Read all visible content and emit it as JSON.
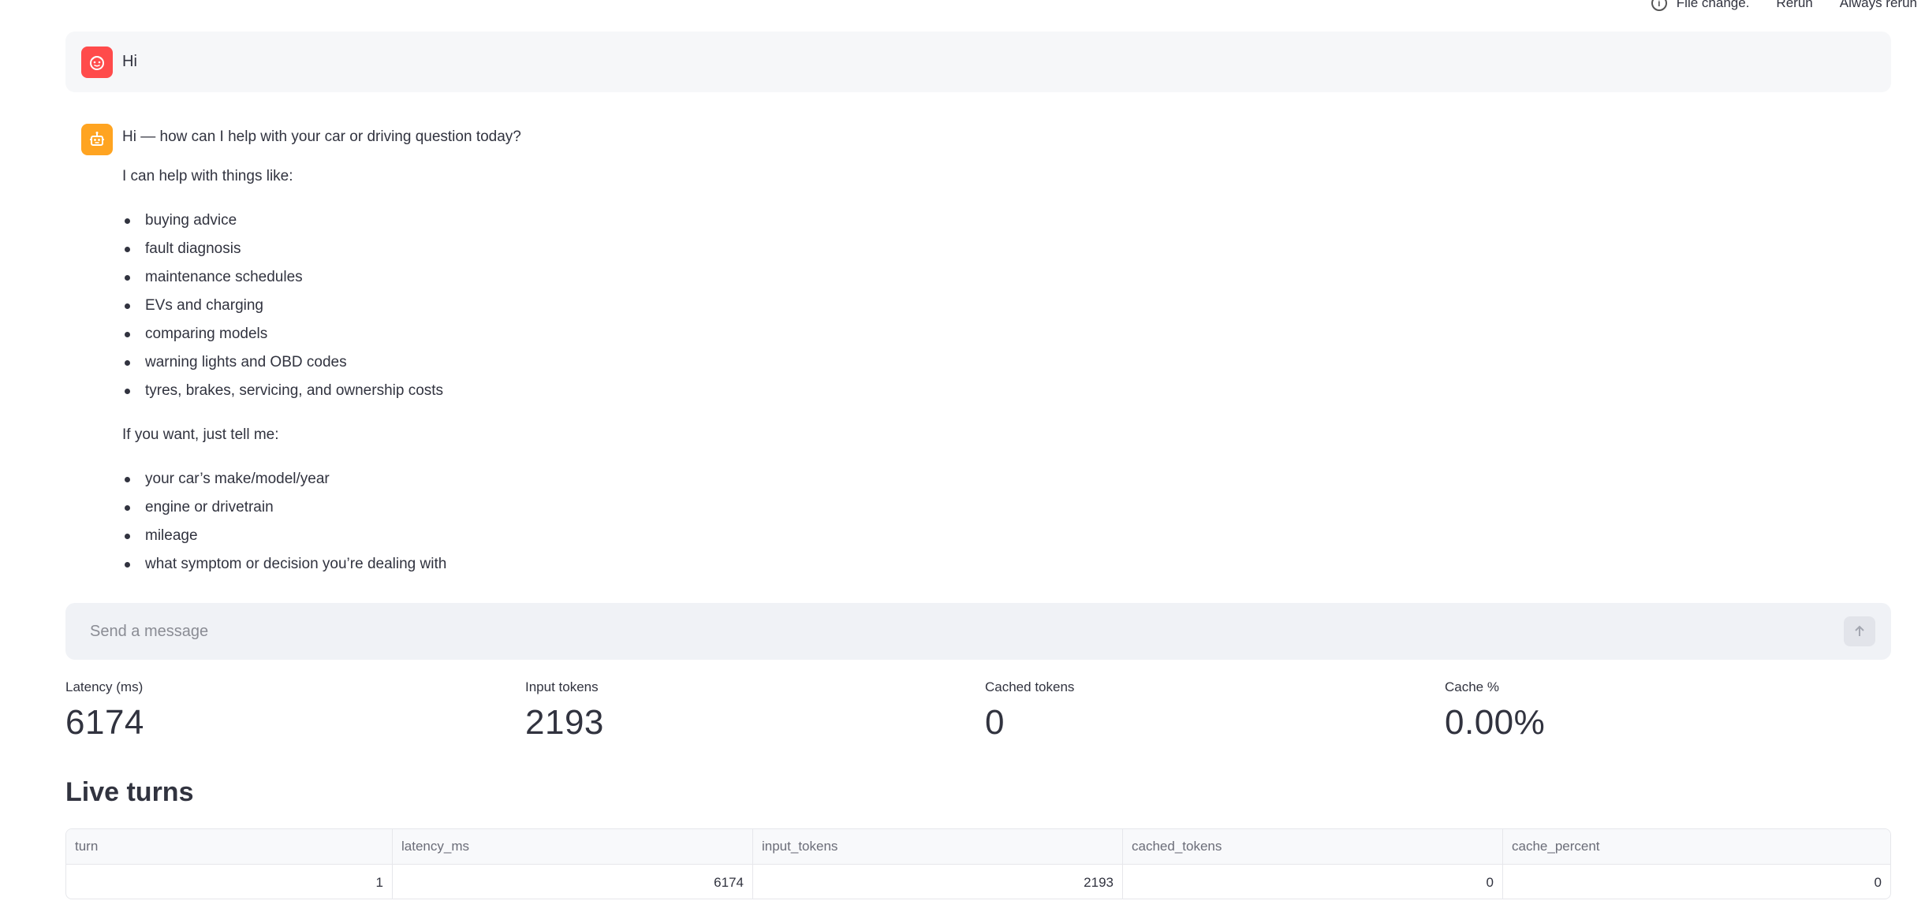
{
  "topbar": {
    "file_change_text": "File change.",
    "rerun_label": "Rerun",
    "always_rerun_label": "Always rerun"
  },
  "messages": {
    "user_text": "Hi",
    "assistant": {
      "intro": "Hi — how can I help with your car or driving question today?",
      "help_heading": "I can help with things like:",
      "help_items": [
        "buying advice",
        "fault diagnosis",
        "maintenance schedules",
        "EVs and charging",
        "comparing models",
        "warning lights and OBD codes",
        "tyres, brakes, servicing, and ownership costs"
      ],
      "tell_heading": "If you want, just tell me:",
      "tell_items": [
        "your car’s make/model/year",
        "engine or drivetrain",
        "mileage",
        "what symptom or decision you’re dealing with"
      ]
    }
  },
  "chat_input": {
    "placeholder": "Send a message"
  },
  "metrics": [
    {
      "label": "Latency (ms)",
      "value": "6174"
    },
    {
      "label": "Input tokens",
      "value": "2193"
    },
    {
      "label": "Cached tokens",
      "value": "0"
    },
    {
      "label": "Cache %",
      "value": "0.00%"
    }
  ],
  "live_turns": {
    "title": "Live turns",
    "columns": [
      "turn",
      "latency_ms",
      "input_tokens",
      "cached_tokens",
      "cache_percent"
    ],
    "rows": [
      [
        "1",
        "6174",
        "2193",
        "0",
        "0"
      ]
    ]
  },
  "colors": {
    "user_avatar": "#ff4b4b",
    "assistant_avatar": "#ffa421",
    "text": "#31333f"
  }
}
